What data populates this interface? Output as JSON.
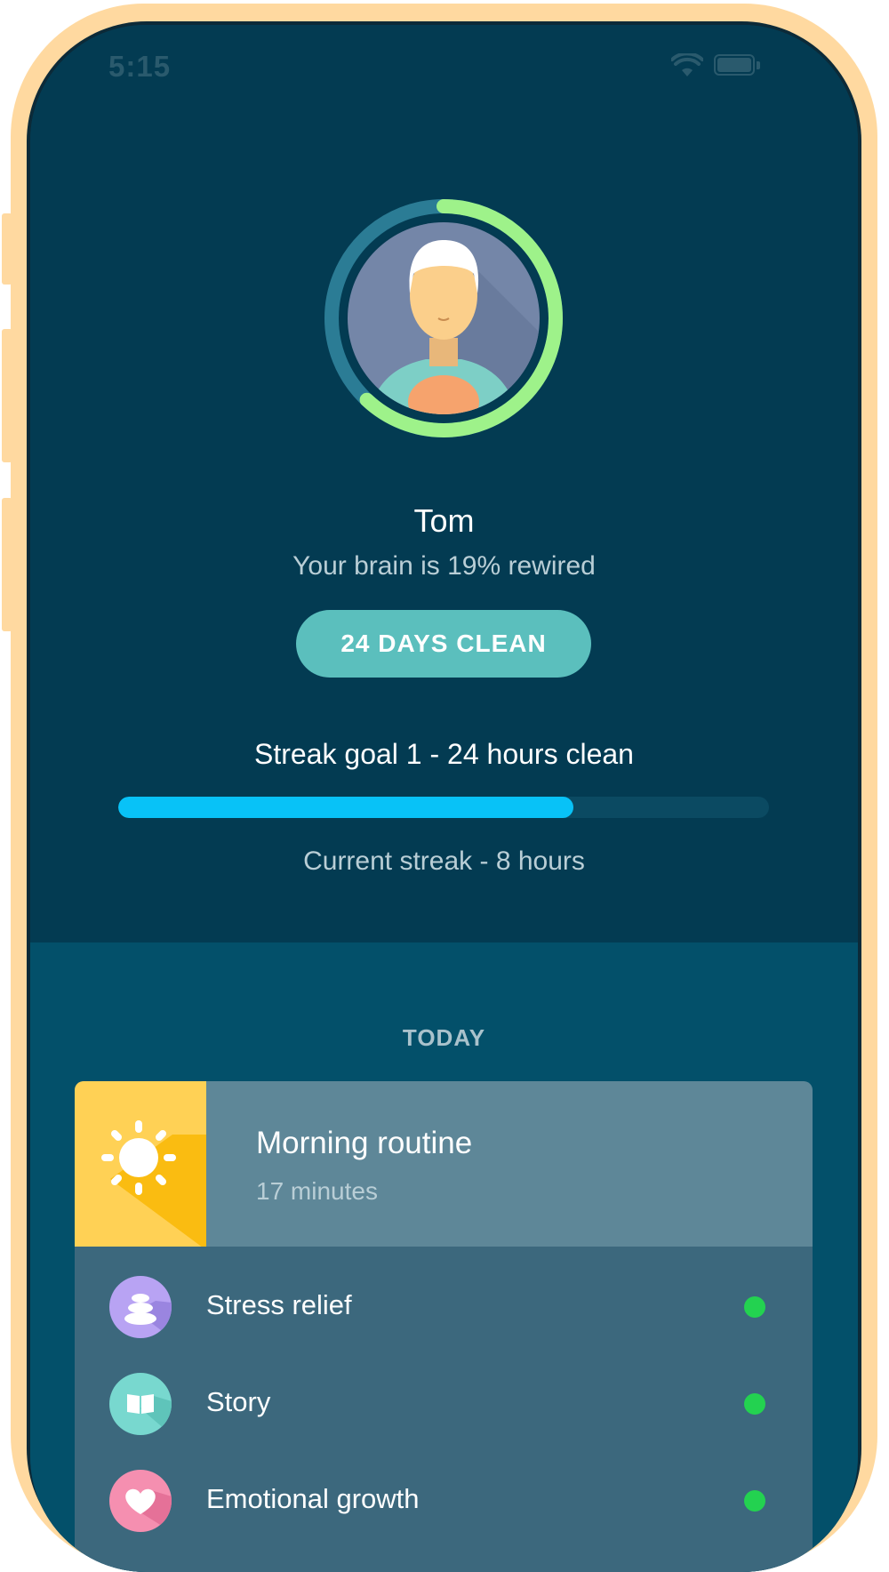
{
  "status_bar": {
    "time": "5:15",
    "wifi_icon": "wifi-icon",
    "battery_icon": "battery-icon"
  },
  "profile": {
    "name": "Tom",
    "rewired_text": "Your brain is 19% rewired",
    "ring_progress": 0.62,
    "avatar_icon": "person-avatar-icon"
  },
  "badge": {
    "label": "24 DAYS CLEAN"
  },
  "streak": {
    "goal_text": "Streak goal 1 - 24 hours clean",
    "progress": 0.7,
    "current_text": "Current streak - 8 hours"
  },
  "today": {
    "heading": "TODAY",
    "routine": {
      "title": "Morning routine",
      "subtitle": "17 minutes",
      "icon": "sun-icon"
    },
    "activities": [
      {
        "label": "Stress relief",
        "icon": "stones-icon",
        "icon_color": "#b8a3f3",
        "done": true
      },
      {
        "label": "Story",
        "icon": "book-icon",
        "icon_color": "#78d8cf",
        "done": true
      },
      {
        "label": "Emotional growth",
        "icon": "heart-icon",
        "icon_color": "#f58fb0",
        "done": true
      }
    ]
  },
  "colors": {
    "background_top": "#033b52",
    "background_bottom": "#03506a",
    "accent_teal": "#5bbfbd",
    "progress_blue": "#08c2f7",
    "ring_green": "#9ef28a",
    "done_green": "#23d250",
    "frame": "#ffd9a0"
  }
}
